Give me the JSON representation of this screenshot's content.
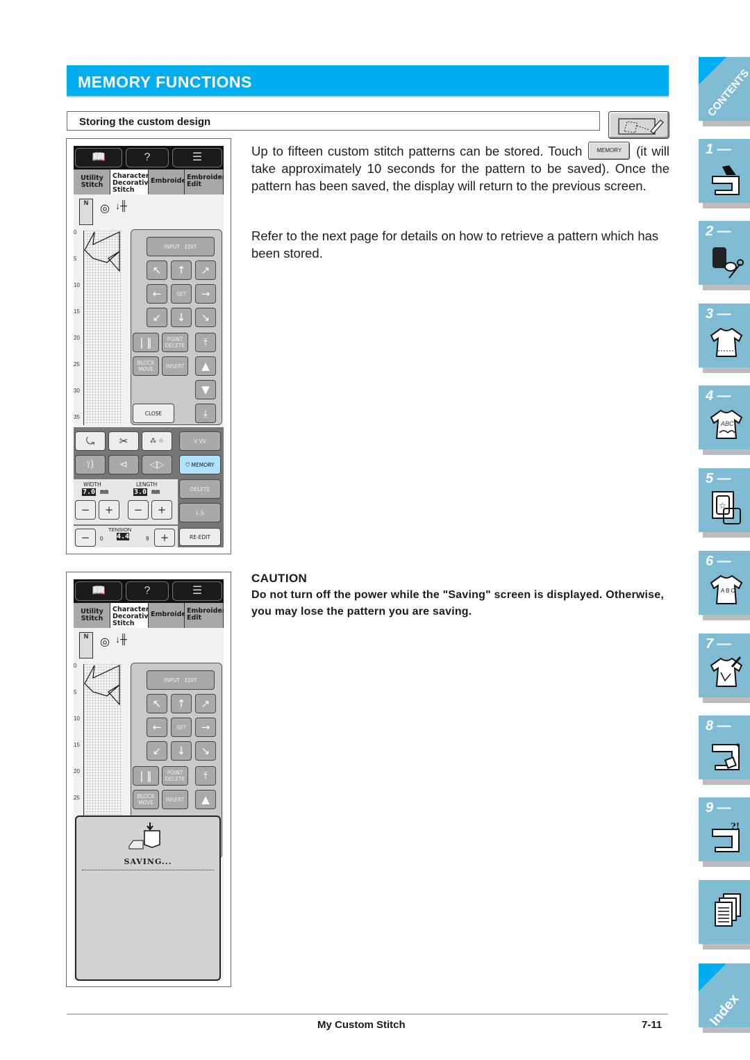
{
  "section": {
    "title": "MEMORY FUNCTIONS",
    "subheading": "Storing the custom design",
    "subheading_icon": "custom-stitch-edit-icon"
  },
  "body": {
    "p1_before": "Up to fifteen custom stitch patterns can be stored. Touch",
    "p1_inline_button": "MEMORY",
    "p1_after": "(it will take approximately 10 seconds for the pattern to be saved). Once the pattern has been saved, the display will return to the previous screen.",
    "p2": "Refer to the next page for details on how to retrieve a pattern which has been stored."
  },
  "caution": {
    "heading": "CAUTION",
    "text": "Do not turn off the power while the \"Saving\" screen is displayed. Otherwise, you may lose the pattern you are saving."
  },
  "lcd": {
    "tabs": [
      "Utility Stitch",
      "Character Decorative Stitch",
      "Embroidery",
      "Embroidery Edit"
    ],
    "active_tab": "Character Decorative Stitch",
    "foot_label": "N",
    "ruler_ticks": [
      "0",
      "5",
      "10",
      "15",
      "20",
      "25",
      "30",
      "35"
    ],
    "buttons": {
      "input": "INPUT",
      "edit": "EDIT",
      "set": "SET",
      "point_delete": "POINT DELETE",
      "block_move": "BLOCK MOVE",
      "insert": "INSERT",
      "close": "CLOSE",
      "memory": "MEMORY",
      "delete": "DELETE",
      "ls": "L  S",
      "re_edit": "RE-EDIT"
    },
    "width_label": "WIDTH",
    "width_value": "7.0",
    "length_label": "LENGTH",
    "length_value": "3.0",
    "unit": "mm",
    "tension_label": "TENSION",
    "tension_min": "0",
    "tension_max": "9",
    "tension_value": "4.4",
    "saving_text": "SAVING..."
  },
  "side_tabs": [
    {
      "label": "CONTENTS",
      "icon": "contents-icon"
    },
    {
      "label": "1 —",
      "icon": "sewing-machine-hand-icon"
    },
    {
      "label": "2 —",
      "icon": "thread-scissors-icon"
    },
    {
      "label": "3 —",
      "icon": "shirt-icon"
    },
    {
      "label": "4 —",
      "icon": "shirt-abc-icon"
    },
    {
      "label": "5 —",
      "icon": "embroidery-frame-icon"
    },
    {
      "label": "6 —",
      "icon": "shirt-abc-arc-icon"
    },
    {
      "label": "7 —",
      "icon": "shirt-pen-icon"
    },
    {
      "label": "8 —",
      "icon": "machine-maintenance-icon"
    },
    {
      "label": "9 —",
      "icon": "machine-troubleshoot-icon"
    },
    {
      "label": "",
      "icon": "documents-icon"
    },
    {
      "label": "Index",
      "icon": "index-icon"
    }
  ],
  "footer": {
    "chapter": "My Custom Stitch",
    "page": "7-11"
  },
  "colors": {
    "accent": "#00aeef",
    "tab_blue": "#7fbcd3",
    "memory_button": "#aee3fb"
  }
}
